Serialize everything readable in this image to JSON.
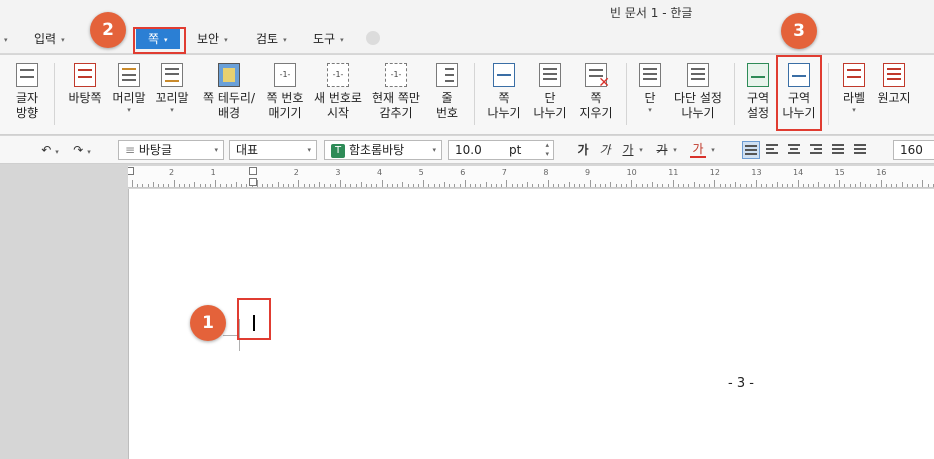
{
  "window": {
    "title": "빈 문서 1 - 한글"
  },
  "menus": [
    {
      "id": "input",
      "label": "입력"
    },
    {
      "id": "page",
      "label": "쪽",
      "active": true
    },
    {
      "id": "security",
      "label": "보안"
    },
    {
      "id": "review",
      "label": "검토"
    },
    {
      "id": "tools",
      "label": "도구"
    }
  ],
  "ribbon": {
    "char_direction": {
      "l1": "글자",
      "l2": "방향"
    },
    "master_page": {
      "l1": "바탕쪽"
    },
    "header": {
      "l1": "머리말"
    },
    "footer": {
      "l1": "꼬리말"
    },
    "page_border": {
      "l1": "쪽 테두리/",
      "l2": "배경"
    },
    "page_number": {
      "l1": "쪽 번호",
      "l2": "매기기"
    },
    "new_number": {
      "l1": "새 번호로",
      "l2": "시작"
    },
    "hide_current": {
      "l1": "현재 쪽만",
      "l2": "감추기"
    },
    "line_number": {
      "l1": "줄",
      "l2": "번호"
    },
    "page_break": {
      "l1": "쪽",
      "l2": "나누기"
    },
    "column_break": {
      "l1": "단",
      "l2": "나누기"
    },
    "page_delete": {
      "l1": "쪽",
      "l2": "지우기"
    },
    "columns": {
      "l1": "단"
    },
    "multi_column": {
      "l1": "다단 설정",
      "l2": "나누기"
    },
    "section_settings": {
      "l1": "구역",
      "l2": "설정"
    },
    "section_break": {
      "l1": "구역",
      "l2": "나누기"
    },
    "label": {
      "l1": "라벨"
    },
    "manuscript": {
      "l1": "원고지"
    }
  },
  "format_bar": {
    "style": "바탕글",
    "lang": "대표",
    "font": "함초롬바탕",
    "font_icon": "T",
    "size": "10.0",
    "unit": "pt",
    "bold": "가",
    "italic": "가",
    "underline": "가",
    "strike": "가",
    "color_char": "가",
    "spacing": "160"
  },
  "ruler": {
    "labels": [
      "2",
      "1",
      "1",
      "2",
      "3",
      "4",
      "5",
      "6",
      "7",
      "8",
      "9",
      "10",
      "11",
      "12",
      "13",
      "14",
      "15",
      "16"
    ]
  },
  "document": {
    "page_number": "- 3 -"
  },
  "annotations": [
    "1",
    "2",
    "3"
  ],
  "colors": {
    "accent": "#2b7fd4",
    "badge": "#e4623a",
    "highlight": "#e03c31"
  }
}
